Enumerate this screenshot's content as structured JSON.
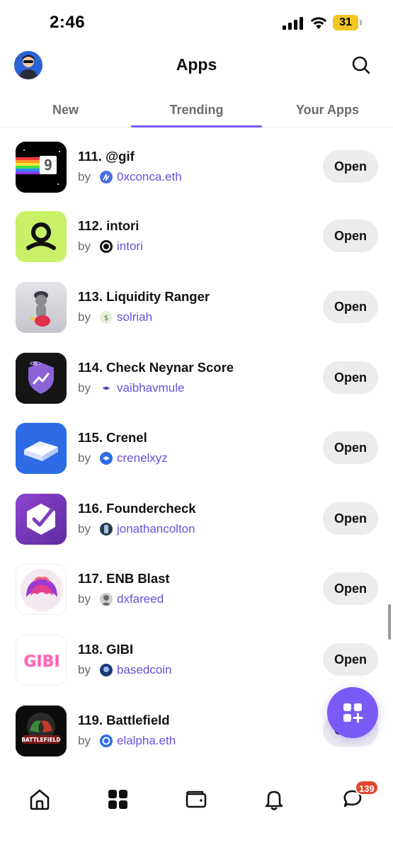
{
  "status_bar": {
    "time": "2:46",
    "battery": "31"
  },
  "header": {
    "title": "Apps"
  },
  "tabs": [
    {
      "label": "New"
    },
    {
      "label": "Trending",
      "active": true
    },
    {
      "label": "Your Apps"
    }
  ],
  "apps": [
    {
      "name": "111. @gif",
      "by": "by",
      "author": "0xconca.eth",
      "button": "Open"
    },
    {
      "name": "112. intori",
      "by": "by",
      "author": "intori",
      "button": "Open"
    },
    {
      "name": "113. Liquidity Ranger",
      "by": "by",
      "author": "solriah",
      "button": "Open"
    },
    {
      "name": "114. Check Neynar Score",
      "by": "by",
      "author": "vaibhavmule",
      "button": "Open"
    },
    {
      "name": "115. Crenel",
      "by": "by",
      "author": "crenelxyz",
      "button": "Open"
    },
    {
      "name": "116. Foundercheck",
      "by": "by",
      "author": "jonathancolton",
      "button": "Open"
    },
    {
      "name": "117. ENB Blast",
      "by": "by",
      "author": "dxfareed",
      "button": "Open"
    },
    {
      "name": "118. GIBI",
      "by": "by",
      "author": "basedcoin",
      "button": "Open",
      "icon_text": "GIBI"
    },
    {
      "name": "119. Battlefield",
      "by": "by",
      "author": "elalpha.eth",
      "button": "Open",
      "icon_text": "BATTLEFIELD"
    }
  ],
  "bottom_nav": [
    {
      "icon": "home-icon"
    },
    {
      "icon": "apps-grid-icon"
    },
    {
      "icon": "wallet-icon"
    },
    {
      "icon": "bell-icon"
    },
    {
      "icon": "chat-icon"
    }
  ],
  "notifications": {
    "chat_badge": "139"
  },
  "colors": {
    "accent": "#7a5af5",
    "author_link": "#6a4fd8",
    "badge": "#e0482f",
    "button_bg": "#ececec"
  }
}
